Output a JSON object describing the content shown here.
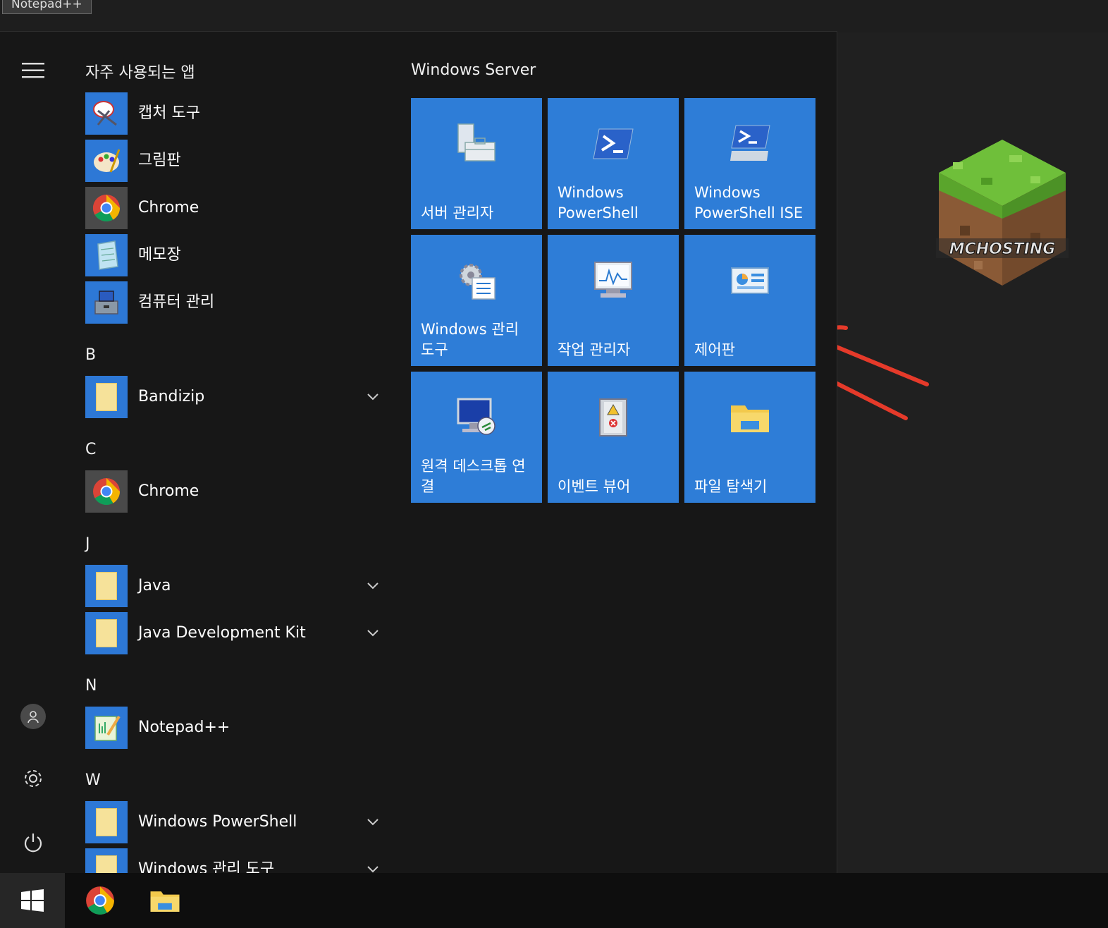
{
  "window_tab": "Notepad++",
  "rail": {
    "menu_icon": "hamburger-icon",
    "user_icon": "user-icon",
    "settings_icon": "gear-icon",
    "power_icon": "power-icon"
  },
  "frequent": {
    "heading": "자주 사용되는 앱",
    "items": [
      {
        "label": "캡처 도구",
        "icon": "snipping-tool-icon"
      },
      {
        "label": "그림판",
        "icon": "paint-icon"
      },
      {
        "label": "Chrome",
        "icon": "chrome-icon"
      },
      {
        "label": "메모장",
        "icon": "notepad-icon"
      },
      {
        "label": "컴퓨터 관리",
        "icon": "computer-management-icon"
      }
    ]
  },
  "sections": [
    {
      "letter": "B",
      "items": [
        {
          "label": "Bandizip",
          "folder": true
        }
      ]
    },
    {
      "letter": "C",
      "items": [
        {
          "label": "Chrome",
          "folder": false
        }
      ]
    },
    {
      "letter": "J",
      "items": [
        {
          "label": "Java",
          "folder": true
        },
        {
          "label": "Java Development Kit",
          "folder": true
        }
      ]
    },
    {
      "letter": "N",
      "items": [
        {
          "label": "Notepad++",
          "folder": false
        }
      ]
    },
    {
      "letter": "W",
      "items": [
        {
          "label": "Windows PowerShell",
          "folder": true
        },
        {
          "label": "Windows 관리 도구",
          "folder": true
        }
      ]
    }
  ],
  "tiles": {
    "group_title": "Windows Server",
    "items": [
      {
        "label": "서버 관리자",
        "icon": "server-manager-icon"
      },
      {
        "label": "Windows PowerShell",
        "icon": "powershell-icon"
      },
      {
        "label": "Windows PowerShell ISE",
        "icon": "powershell-ise-icon"
      },
      {
        "label": "Windows 관리 도구",
        "icon": "admin-tools-icon"
      },
      {
        "label": "작업 관리자",
        "icon": "task-manager-icon"
      },
      {
        "label": "제어판",
        "icon": "control-panel-icon"
      },
      {
        "label": "원격 데스크톱 연결",
        "icon": "remote-desktop-icon"
      },
      {
        "label": "이벤트 뷰어",
        "icon": "event-viewer-icon"
      },
      {
        "label": "파일 탐색기",
        "icon": "file-explorer-icon"
      }
    ]
  },
  "logo_text": "MCHOSTING",
  "taskbar": {
    "start_icon": "windows-logo-icon",
    "apps": [
      {
        "name": "Chrome",
        "icon": "chrome-icon"
      },
      {
        "name": "File Explorer",
        "icon": "file-explorer-icon"
      }
    ]
  },
  "annotation_color": "#e53a2a",
  "tile_color": "#2e7dd7"
}
